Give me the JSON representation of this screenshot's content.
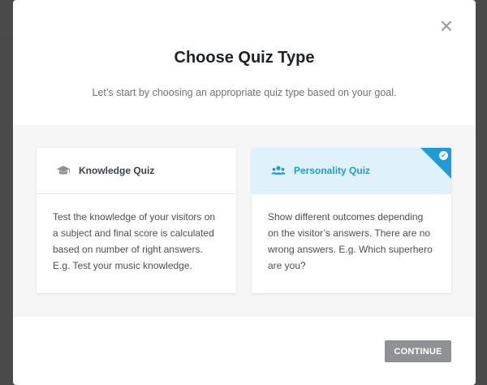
{
  "modal": {
    "title": "Choose Quiz Type",
    "subtitle": "Let’s start by choosing an appropriate quiz type based on your goal.",
    "close_icon": "close-icon",
    "continue_label": "CONTINUE"
  },
  "cards": [
    {
      "label": "Knowledge Quiz",
      "icon": "graduation-cap-icon",
      "description": "Test the knowledge of your visitors on a subject and final score is calculated based on number of right answers. E.g. Test your music knowledge.",
      "selected": false
    },
    {
      "label": "Personality Quiz",
      "icon": "users-icon",
      "description": "Show different outcomes depending on the visitor’s answers. There are no wrong answers. E.g. Which superhero are you?",
      "selected": true
    }
  ],
  "colors": {
    "accent": "#1f9cd8",
    "selected_header_bg": "#dff2fb",
    "button_bg": "#8e9196",
    "overlay": "#4a4a4a"
  }
}
